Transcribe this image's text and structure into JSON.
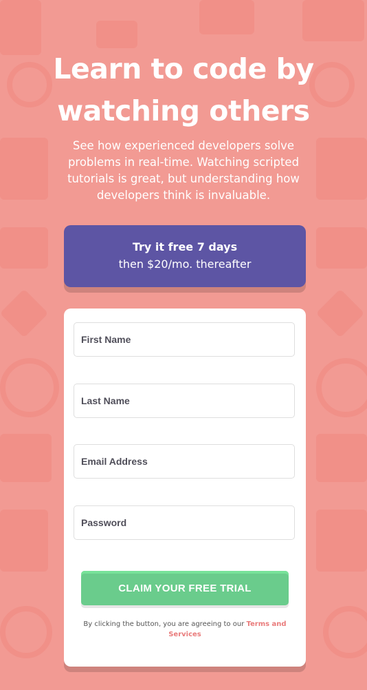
{
  "hero": {
    "title": "Learn to code by watching others",
    "description": "See how experienced developers solve problems in real-time. Watching scripted tutorials is great, but understanding how developers think is invaluable."
  },
  "promo": {
    "headline": "Try it free 7 days",
    "subtext": "then $20/mo. thereafter"
  },
  "form": {
    "first_name_placeholder": "First Name",
    "last_name_placeholder": "Last Name",
    "email_placeholder": "Email Address",
    "password_placeholder": "Password",
    "submit_label": "CLAIM YOUR FREE TRIAL",
    "terms_prefix": "By clicking the button, you are agreeing to our ",
    "terms_link": "Terms and Services"
  },
  "colors": {
    "background": "#f29a93",
    "promo": "#5d55a4",
    "button": "#6acc8c",
    "link": "#e97b7b"
  }
}
